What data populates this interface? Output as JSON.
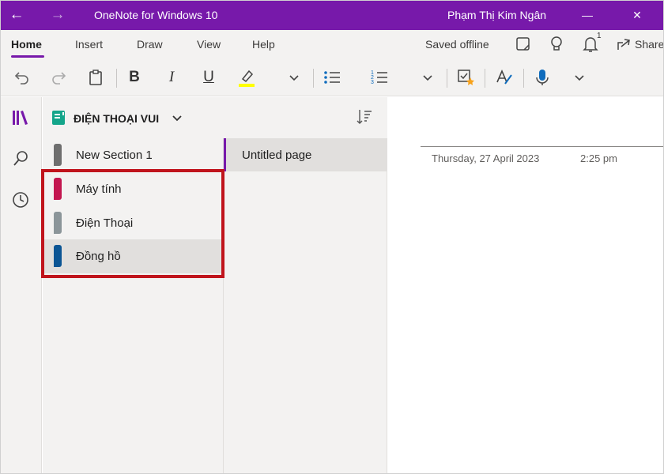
{
  "titlebar": {
    "app_title": "OneNote for Windows 10",
    "user_name": "Phạm Thị Kim Ngân",
    "back_glyph": "←",
    "forward_glyph": "→",
    "minimize_glyph": "—",
    "close_glyph": "✕",
    "color": "#7719aa"
  },
  "tabs": {
    "items": [
      {
        "label": "Home",
        "active": true
      },
      {
        "label": "Insert"
      },
      {
        "label": "Draw"
      },
      {
        "label": "View"
      },
      {
        "label": "Help"
      }
    ],
    "saved_status": "Saved offline",
    "notification_count": "1",
    "share_label": "Share"
  },
  "ribbon": {
    "bold_glyph": "B",
    "italic_glyph": "I",
    "underline_glyph": "U",
    "highlight_color": "#ffff00",
    "icons": [
      "undo-icon",
      "redo-icon",
      "paste-icon",
      "bold-icon",
      "italic-icon",
      "underline-icon",
      "highlighter-icon",
      "bullet-list-icon",
      "numbered-list-icon",
      "todo-tag-icon",
      "spelling-icon",
      "dictate-icon"
    ]
  },
  "notebook": {
    "name": "ĐIỆN THOẠI VUI",
    "icon_color": "#14a58a"
  },
  "sections": [
    {
      "label": "New Section 1",
      "color": "#6e6e6e",
      "selected": false
    },
    {
      "label": "Máy tính",
      "color": "#c3164f",
      "selected": false
    },
    {
      "label": "Điện Thoại",
      "color": "#8b9599",
      "selected": false
    },
    {
      "label": "Đồng hồ",
      "color": "#0b5594",
      "selected": true
    }
  ],
  "pages": [
    {
      "label": "Untitled page",
      "selected": true
    }
  ],
  "canvas": {
    "date": "Thursday, 27 April 2023",
    "time": "2:25 pm"
  },
  "highlight_color": "#c0141c"
}
